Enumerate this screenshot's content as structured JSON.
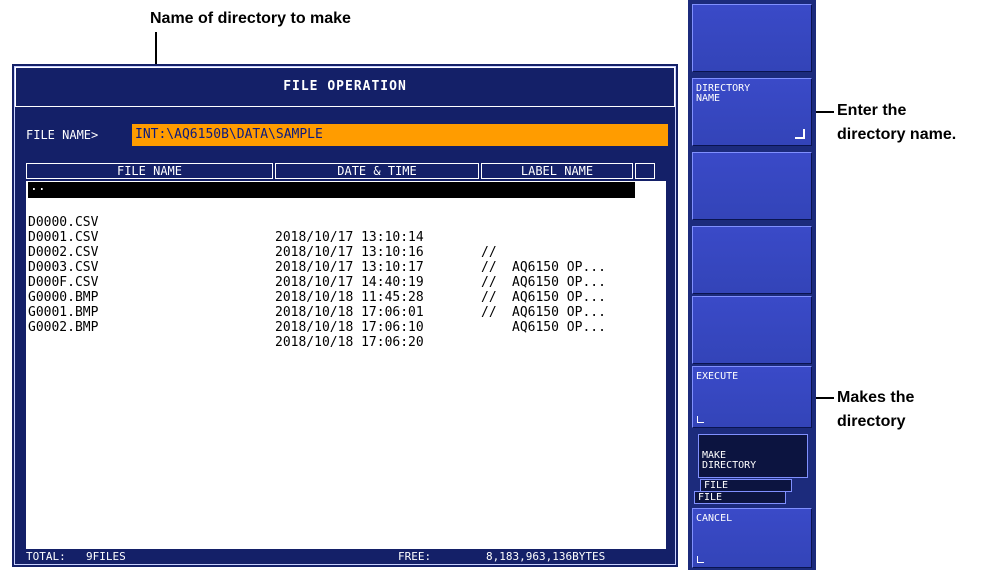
{
  "annotations": {
    "dirname_label": "Name of directory to make",
    "enter_label_1": "Enter the",
    "enter_label_2": "directory name.",
    "makes_label_1": "Makes the",
    "makes_label_2": "directory"
  },
  "dialog": {
    "title": "FILE OPERATION",
    "file_name_label": "FILE NAME>",
    "file_name_value": "INT:\\AQ6150B\\DATA\\SAMPLE",
    "columns": [
      "FILE NAME",
      "DATE & TIME",
      "LABEL NAME"
    ],
    "parent_entry": "..",
    "files": [
      {
        "name": "D0000.CSV",
        "date": "2018/10/17 13:10:14",
        "sep": "//",
        "label": "AQ6150 OP..."
      },
      {
        "name": "D0001.CSV",
        "date": "2018/10/17 13:10:16",
        "sep": "//",
        "label": "AQ6150 OP..."
      },
      {
        "name": "D0002.CSV",
        "date": "2018/10/17 13:10:17",
        "sep": "//",
        "label": "AQ6150 OP..."
      },
      {
        "name": "D0003.CSV",
        "date": "2018/10/17 14:40:19",
        "sep": "//",
        "label": "AQ6150 OP..."
      },
      {
        "name": "D000F.CSV",
        "date": "2018/10/18 11:45:28",
        "sep": "//",
        "label": "AQ6150 OP..."
      },
      {
        "name": "G0000.BMP",
        "date": "2018/10/18 17:06:01",
        "sep": "",
        "label": ""
      },
      {
        "name": "G0001.BMP",
        "date": "2018/10/18 17:06:10",
        "sep": "",
        "label": ""
      },
      {
        "name": "G0002.BMP",
        "date": "2018/10/18 17:06:20",
        "sep": "",
        "label": ""
      }
    ],
    "status": {
      "total_label": "TOTAL:",
      "total_value": "9FILES",
      "free_label": "FREE:",
      "free_value": "8,183,963,136BYTES"
    }
  },
  "softkeys": {
    "directory_name_1": "DIRECTORY",
    "directory_name_2": "NAME",
    "execute": "EXECUTE",
    "make_directory_1": "MAKE",
    "make_directory_2": "DIRECTORY",
    "file_tab_1": "FILE",
    "file_tab_2": "FILE",
    "cancel": "CANCEL"
  },
  "colors": {
    "dialog_bg": "#142068",
    "filename_field": "#ff9c00",
    "softkey": "#3344b8"
  }
}
